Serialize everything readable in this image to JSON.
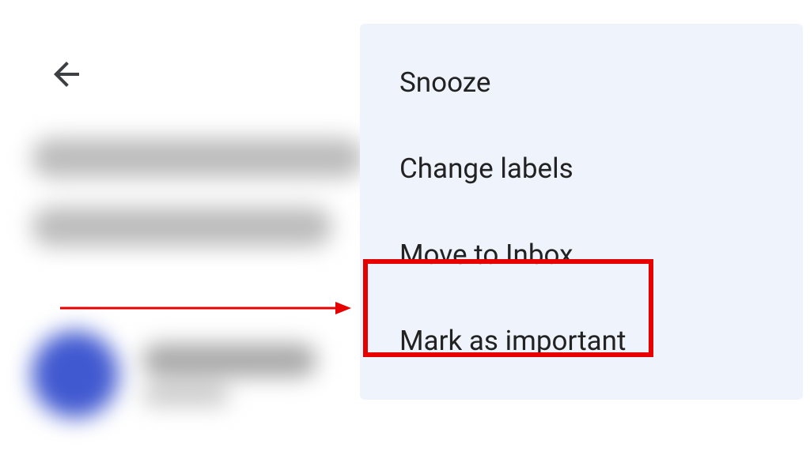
{
  "menu": {
    "items": [
      {
        "label": "Snooze"
      },
      {
        "label": "Change labels"
      },
      {
        "label": "Move to Inbox"
      },
      {
        "label": "Mark as important"
      }
    ],
    "highlighted_index": 2
  },
  "annotation": {
    "highlight_color": "#e60000"
  }
}
